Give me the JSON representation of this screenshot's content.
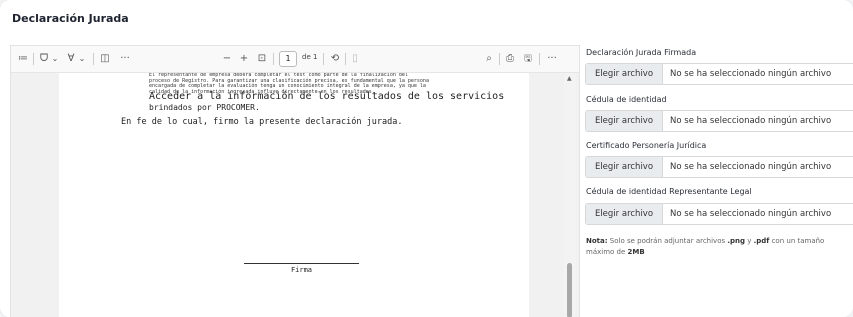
{
  "page": {
    "title": "Declaración Jurada"
  },
  "viewer": {
    "toolbar": {
      "menu_icon": "≔",
      "highlight_icon": "ᗜ",
      "dropdown1": "⌄",
      "draw_icon": "∀",
      "dropdown2": "⌄",
      "sidebar_icon": "◫",
      "more_icon": "···",
      "zoom_out": "−",
      "zoom_in": "+",
      "fit_icon": "⊡",
      "page_number": "1",
      "page_of": "de 1",
      "rotate_icon": "⟲",
      "view_icon": "▯",
      "search_icon": "⌕",
      "print_icon": "⎙",
      "save_icon": "🖫",
      "overflow_icon": "···"
    },
    "document": {
      "small_lines": [
        "El representante de empresa deberá completar el test como parte de la finalización del",
        "proceso de Registro. Para garantizar una clasificación precisa, es fundamental que la persona",
        "encargada de completar la evaluación tenga un conocimiento integral de la empresa, ya que la",
        "calidad de la información ingresada influye directamente en los resultados."
      ],
      "big_line1": "Acceder a la información de los resultados de los servicios",
      "big_line2": "brindados por PROCOMER.",
      "closing": "En fe de lo cual, firmo la presente declaración jurada.",
      "signature_label": "Firma"
    }
  },
  "form": {
    "fields": [
      {
        "label": "Declaración Jurada Firmada",
        "button": "Elegir archivo",
        "status": "No se ha seleccionado ningún archivo"
      },
      {
        "label": "Cédula de identidad",
        "button": "Elegir archivo",
        "status": "No se ha seleccionado ningún archivo"
      },
      {
        "label": "Certificado Personería Jurídica",
        "button": "Elegir archivo",
        "status": "No se ha seleccionado ningún archivo"
      },
      {
        "label": "Cédula de identidad Representante Legal",
        "button": "Elegir archivo",
        "status": "No se ha seleccionado ningún archivo"
      }
    ],
    "note": {
      "prefix": "Nota:",
      "text1": " Solo se podrán adjuntar archivos ",
      "ext1": ".png",
      "text2": " y ",
      "ext2": ".pdf",
      "text3": " con un tamaño máximo de ",
      "size": "2MB"
    }
  }
}
